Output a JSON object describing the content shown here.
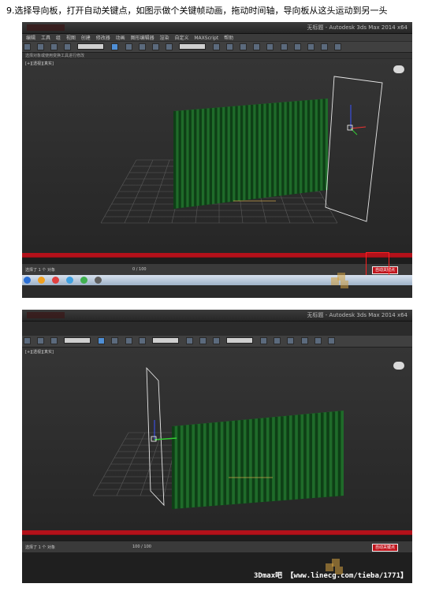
{
  "caption": "9.选择导向板，打开自动关键点，如图示做个关键帧动画，拖动时间轴，导向板从这头运动到另一头",
  "screenshot1": {
    "window_title": "无标题 - Autodesk 3ds Max 2014 x64",
    "menu_items": [
      "编辑",
      "工具",
      "组",
      "视图",
      "创建",
      "修改器",
      "动画",
      "图形编辑器",
      "渲染",
      "自定义",
      "MAXScript",
      "帮助"
    ],
    "toolbar_dropdown": "全部",
    "hint_text": "选择对象或使用变换工具进行修改",
    "viewport_label": "[+][透视][真实]",
    "autokey_label": "自动关键点",
    "frame_counter": "0 / 100",
    "status_text": "选择了 1 个 对象"
  },
  "screenshot2": {
    "window_title": "无标题 - Autodesk 3ds Max 2014 x64",
    "toolbar_dropdown": "全部",
    "viewport_label": "[+][透视][真实]",
    "autokey_label": "自动关键点",
    "frame_counter": "100 / 100",
    "status_text": "选择了 1 个 对象",
    "watermark": "3Dmax吧 【www.linecg.com/tieba/1771】"
  },
  "colors": {
    "timeline_red": "#b3111a",
    "curtain_green": "#1f6b2a",
    "viewport_bg": "#2b2b2b",
    "highlight_box": "#ff2020"
  }
}
